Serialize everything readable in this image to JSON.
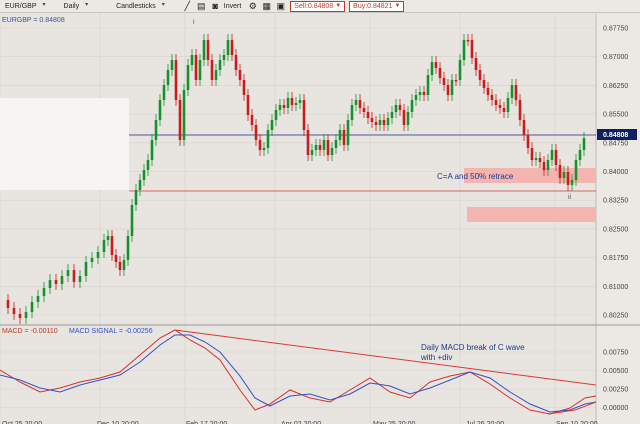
{
  "toolbar": {
    "symbol": "EUR/GBP",
    "timeframe": "Daily",
    "chart_type": "Candlesticks",
    "invert_label": "Invert",
    "sell_label": "Sell:0.84808",
    "buy_label": "Buy:0.84821"
  },
  "price_panel": {
    "label": "EURGBP = 0.84808",
    "current_price": "0.84808",
    "y_ticks": [
      "0.87750",
      "0.87000",
      "0.86250",
      "0.85500",
      "0.84750",
      "0.84000",
      "0.83250",
      "0.82500",
      "0.81750",
      "0.81000",
      "0.80250"
    ],
    "annotations": {
      "retrace": "C=A and 50% retrace",
      "wave_i": "i",
      "wave_ii": "ii"
    }
  },
  "macd_panel": {
    "macd_label": "MACD = -0.00110",
    "signal_label": "MACD SIGNAL = -0.00256",
    "note_line1": "Daily MACD break of C wave",
    "note_line2": "with +div",
    "y_ticks": [
      "0.00750",
      "0.00500",
      "0.00250",
      "0.00000"
    ]
  },
  "x_axis": {
    "dates": [
      "Oct 25 20:00",
      "Dec 10 20:00",
      "Feb 17 20:00",
      "Apr 02 20:00",
      "May 25 20:00",
      "Jul 26 20:00",
      "Sep 10 20:00"
    ]
  },
  "colors": {
    "up": "#17922f",
    "down": "#cc1b1b",
    "price_line": "#1b2a8f",
    "support_line": "#d43a3a",
    "zone": "#f4b4b0",
    "macd": "#d63030",
    "signal": "#3350c8",
    "trend": "#d83a3a"
  }
}
